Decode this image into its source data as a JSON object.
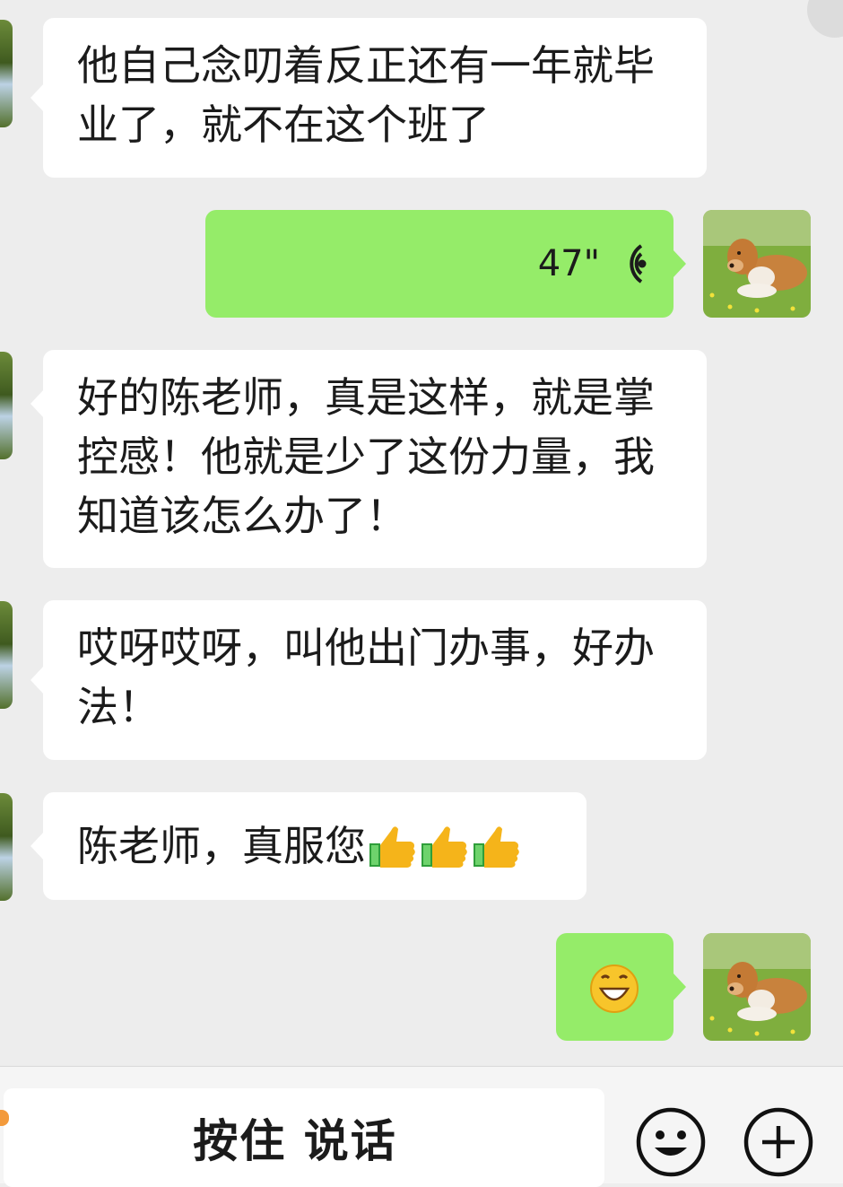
{
  "messages": [
    {
      "side": "in",
      "type": "text",
      "text": "他自己念叨着反正还有一年就毕业了，就不在这个班了"
    },
    {
      "side": "out",
      "type": "voice",
      "duration": "47\""
    },
    {
      "side": "in",
      "type": "text",
      "text": "好的陈老师，真是这样，就是掌控感！他就是少了这份力量，我知道该怎么办了！"
    },
    {
      "side": "in",
      "type": "text",
      "text": "哎呀哎呀，叫他出门办事，好办法！"
    },
    {
      "side": "in",
      "type": "text",
      "text": "陈老师，真服您",
      "emoji": [
        "thumbs-up-icon",
        "thumbs-up-icon",
        "thumbs-up-icon"
      ]
    },
    {
      "side": "out",
      "type": "emoji",
      "emoji": "grin-icon"
    }
  ],
  "input_bar": {
    "hold_to_talk_label": "按住 说话",
    "emoji_button_icon": "smiley-icon",
    "more_button_icon": "plus-circle-icon"
  },
  "colors": {
    "chat_background": "#ededed",
    "incoming_bubble": "#ffffff",
    "outgoing_bubble": "#95ec69"
  }
}
